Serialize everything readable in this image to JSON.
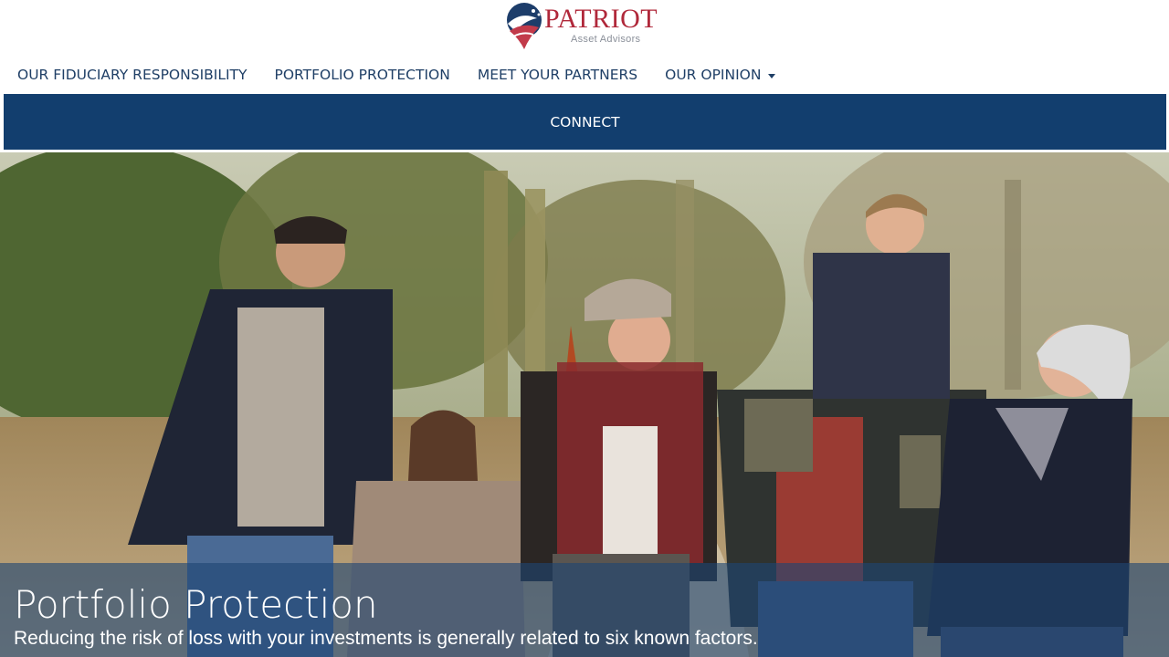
{
  "brand": {
    "name": "PATRIOT",
    "tagline": "Asset Advisors"
  },
  "nav": {
    "items": [
      {
        "label": "OUR FIDUCIARY RESPONSIBILITY"
      },
      {
        "label": "PORTFOLIO PROTECTION"
      },
      {
        "label": "MEET YOUR PARTNERS"
      },
      {
        "label": "OUR OPINION",
        "has_dropdown": true
      }
    ],
    "connect_label": "CONNECT"
  },
  "hero": {
    "title": "Portfolio Protection",
    "subtitle": "Reducing the risk of loss with your investments is generally related to six known factors."
  },
  "colors": {
    "brand_red": "#b0283a",
    "nav_text": "#1f3f66",
    "connect_bar": "#123e6e",
    "caption_overlay": "#1e4673"
  }
}
